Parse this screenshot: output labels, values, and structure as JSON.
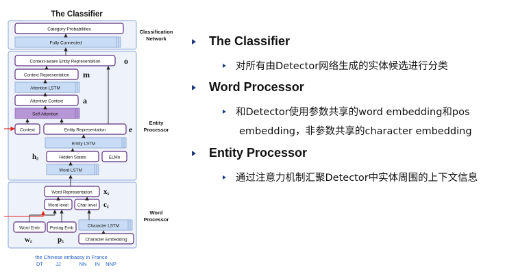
{
  "diagram": {
    "title": "The Classifier",
    "sections": {
      "classification": "Classification\nNetwork",
      "entity": "Entity\nProcessor",
      "word": "Word\nProcessor"
    },
    "boxes": {
      "category_probabilities": "Category Probabilities",
      "fully_connected": "Fully Connected",
      "context_aware": "Context-aware Entity Representation",
      "context_representation": "Context Representation",
      "attention_lstm": "Attention LSTM",
      "attentive_context": "Attentive Context",
      "self_attention": "Self-Attention",
      "context": "Context",
      "entity_representation": "Entity Representation",
      "entity_lstm": "Entity LSTM",
      "hidden_states": "Hidden States",
      "elmo": "ELMo",
      "word_lstm": "Word LSTM",
      "word_representation": "Word Representation",
      "word_level": "Word level",
      "char_level": "Char level",
      "word_emb": "Word Emb",
      "postag_emb": "Postag Emb",
      "character_lstm": "Character LSTM",
      "character_embedding": "Character Embedding"
    },
    "symbols": {
      "o": "o",
      "m": "m",
      "a": "a",
      "e": "e",
      "h": "h",
      "h_sub": "k",
      "x": "x",
      "x_sub": "k",
      "c": "c",
      "c_sub": "k",
      "w": "w",
      "w_sub": "k",
      "p": "p",
      "p_sub": "k"
    },
    "sentence": "the Chinese embassy in France",
    "pos_tags": [
      "DT",
      "JJ",
      "NN",
      "IN",
      "NNP"
    ],
    "colors": {
      "box_border": "#5c2e7a",
      "blue_fill": "#c9dcf5",
      "purple_fill": "#b796d6",
      "section_fill": "#edf2fb",
      "section_border": "#9bb3db",
      "red_arrow": "#e2231a",
      "sentence_blue": "#2461c6"
    }
  },
  "bullets": [
    {
      "title": "The Classifier",
      "items": [
        "对所有由Detector网络生成的实体候选进行分类"
      ]
    },
    {
      "title": "Word Processor",
      "items": [
        "和Detector使用参数共享的word embedding和pos",
        "embedding，非参数共享的character embedding"
      ]
    },
    {
      "title": "Entity Processor",
      "items": [
        "通过注意力机制汇聚Detector中实体周围的上下文信息"
      ]
    }
  ],
  "bullet_color": "#1e3a7a"
}
